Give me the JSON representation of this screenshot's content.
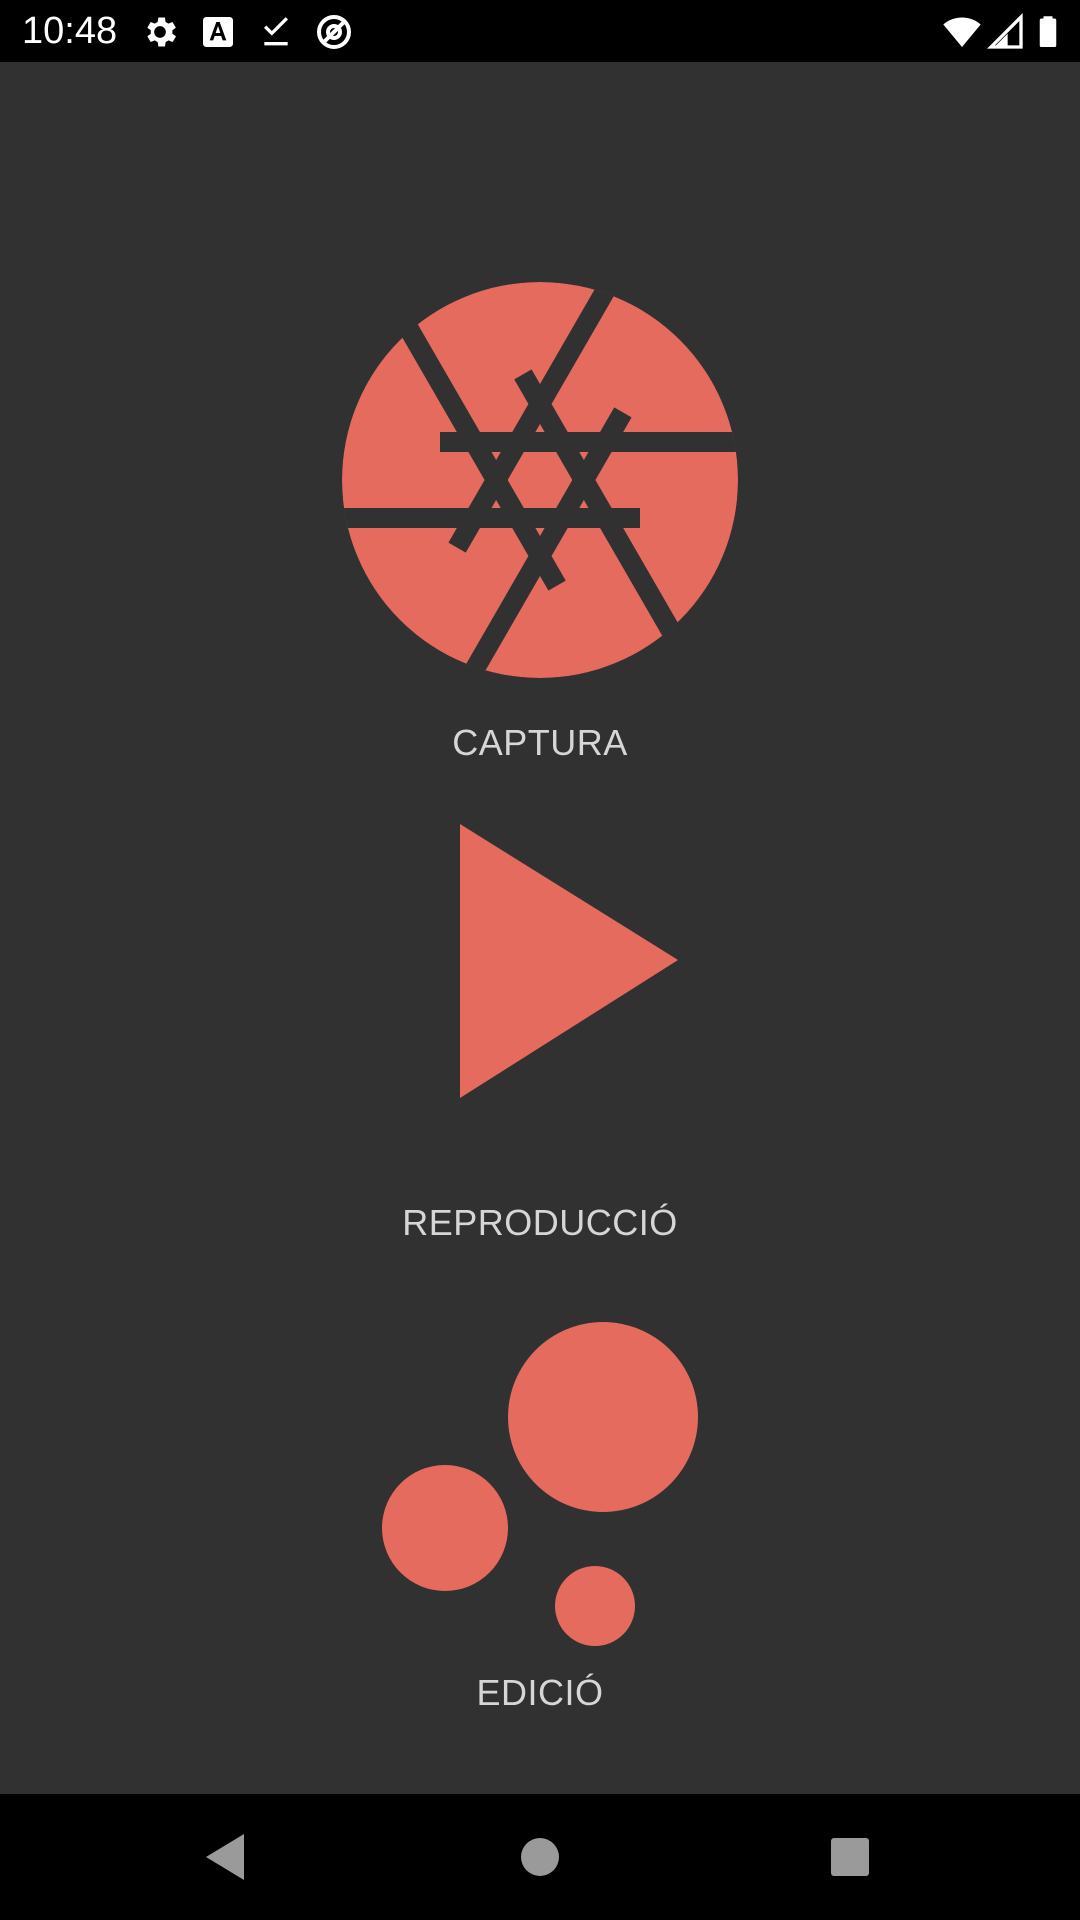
{
  "status_bar": {
    "time": "10:48",
    "left_icons": [
      "gear-icon",
      "text-a-icon",
      "download-done-icon",
      "at-sign-icon"
    ],
    "right_icons": [
      "wifi-icon",
      "cell-signal-icon",
      "battery-icon"
    ]
  },
  "colors": {
    "accent": "#E56B5F",
    "background": "#323132",
    "label": "#D6D6D6",
    "bars": "#000000"
  },
  "menu": {
    "items": [
      {
        "id": "captura",
        "label": "CAPTURA",
        "icon": "aperture-icon"
      },
      {
        "id": "reproduccio",
        "label": "REPRODUCCIÓ",
        "icon": "play-icon"
      },
      {
        "id": "edicio",
        "label": "EDICIÓ",
        "icon": "bubbles-icon"
      }
    ]
  },
  "nav_bar": {
    "buttons": [
      "back-icon",
      "home-icon",
      "recents-icon"
    ]
  }
}
